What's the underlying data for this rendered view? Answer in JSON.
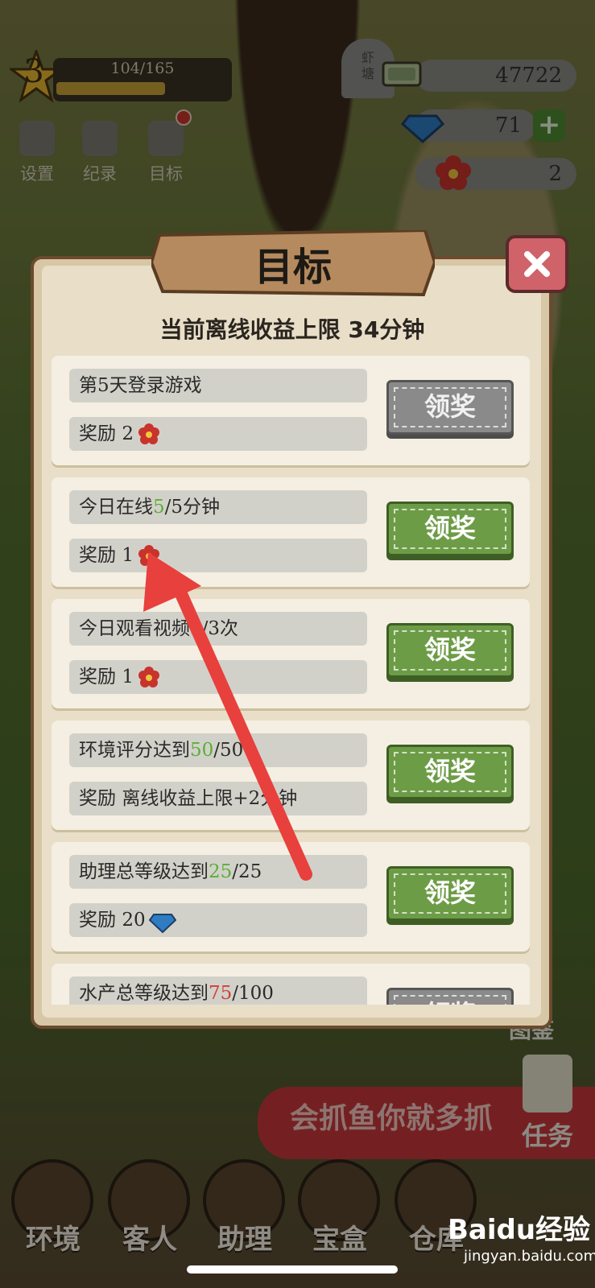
{
  "hud": {
    "level": "3",
    "xp_text": "104/165",
    "xp_fraction": 0.63,
    "sign_text": "虾\n塘",
    "buttons": [
      {
        "label": "设置",
        "icon": "gear-icon"
      },
      {
        "label": "纪录",
        "icon": "notebook-icon"
      },
      {
        "label": "目标",
        "icon": "goal-list-icon"
      }
    ],
    "resources": {
      "cash": "47722",
      "gems": "71",
      "flowers": "2"
    }
  },
  "modal": {
    "title": "目标",
    "subtitle": "当前离线收益上限 34分钟",
    "tasks": [
      {
        "pre": "第5天登录游戏",
        "progress": "",
        "post": "",
        "progress_color": "",
        "reward_prefix": "奖励 ",
        "reward_value": "2",
        "reward_icon": "flower-icon",
        "button": "领奖",
        "button_state": "disabled"
      },
      {
        "pre": "今日在线",
        "progress": "5",
        "post": "/5分钟",
        "progress_color": "green",
        "reward_prefix": "奖励 ",
        "reward_value": "1",
        "reward_icon": "flower-icon",
        "button": "领奖",
        "button_state": "active"
      },
      {
        "pre": "今日观看视频",
        "progress": "3",
        "post": "/3次",
        "progress_color": "green",
        "reward_prefix": "奖励 ",
        "reward_value": "1",
        "reward_icon": "flower-icon",
        "button": "领奖",
        "button_state": "active"
      },
      {
        "pre": "环境评分达到",
        "progress": "50",
        "post": "/50",
        "progress_color": "green",
        "reward_prefix": "奖励 ",
        "reward_value": "离线收益上限+2分钟",
        "reward_icon": "",
        "button": "领奖",
        "button_state": "active"
      },
      {
        "pre": "助理总等级达到",
        "progress": "25",
        "post": "/25",
        "progress_color": "green",
        "reward_prefix": "奖励 ",
        "reward_value": "20",
        "reward_icon": "diamond-icon",
        "button": "领奖",
        "button_state": "active"
      },
      {
        "pre": "水产总等级达到",
        "progress": "75",
        "post": "/100",
        "progress_color": "red",
        "reward_prefix": "",
        "reward_value": "",
        "reward_icon": "",
        "button": "领奖",
        "button_state": "disabled"
      }
    ]
  },
  "bottom": {
    "banner": "会抓鱼你就多抓",
    "task_label": "任务",
    "tujian_label": "图鉴",
    "nav": [
      "环境",
      "客人",
      "助理",
      "宝盒",
      "仓库"
    ],
    "watermark": "Baidu经验",
    "watermark_sub": "jingyan.baidu.com"
  },
  "colors": {
    "progress_green": "#5cae3a",
    "progress_red": "#d0403a",
    "button_green": "#6d9c46",
    "button_grey": "#8a8a8a"
  }
}
